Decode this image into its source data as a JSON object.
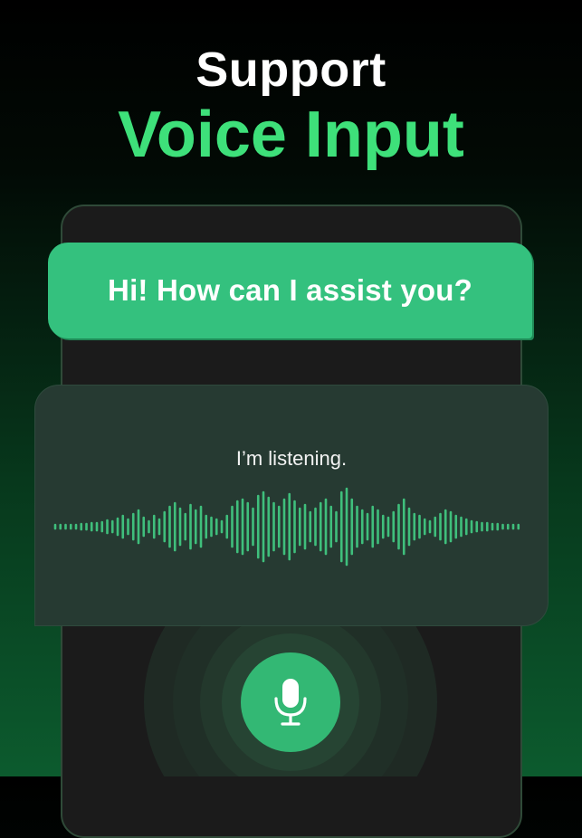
{
  "header": {
    "line1": "Support",
    "line2": "Voice Input"
  },
  "assistant_message": {
    "text": "Hi! How can I assist you?"
  },
  "voice_panel": {
    "status": "I’m listening.",
    "waveform_icon": "audio-waveform",
    "mic_icon": "microphone-icon"
  },
  "colors": {
    "accent_green": "#3ee07a",
    "bubble_green": "#34c17e",
    "mic_green": "#33b874",
    "card_bg": "#263a32",
    "phone_bg": "#1b1b1b"
  }
}
